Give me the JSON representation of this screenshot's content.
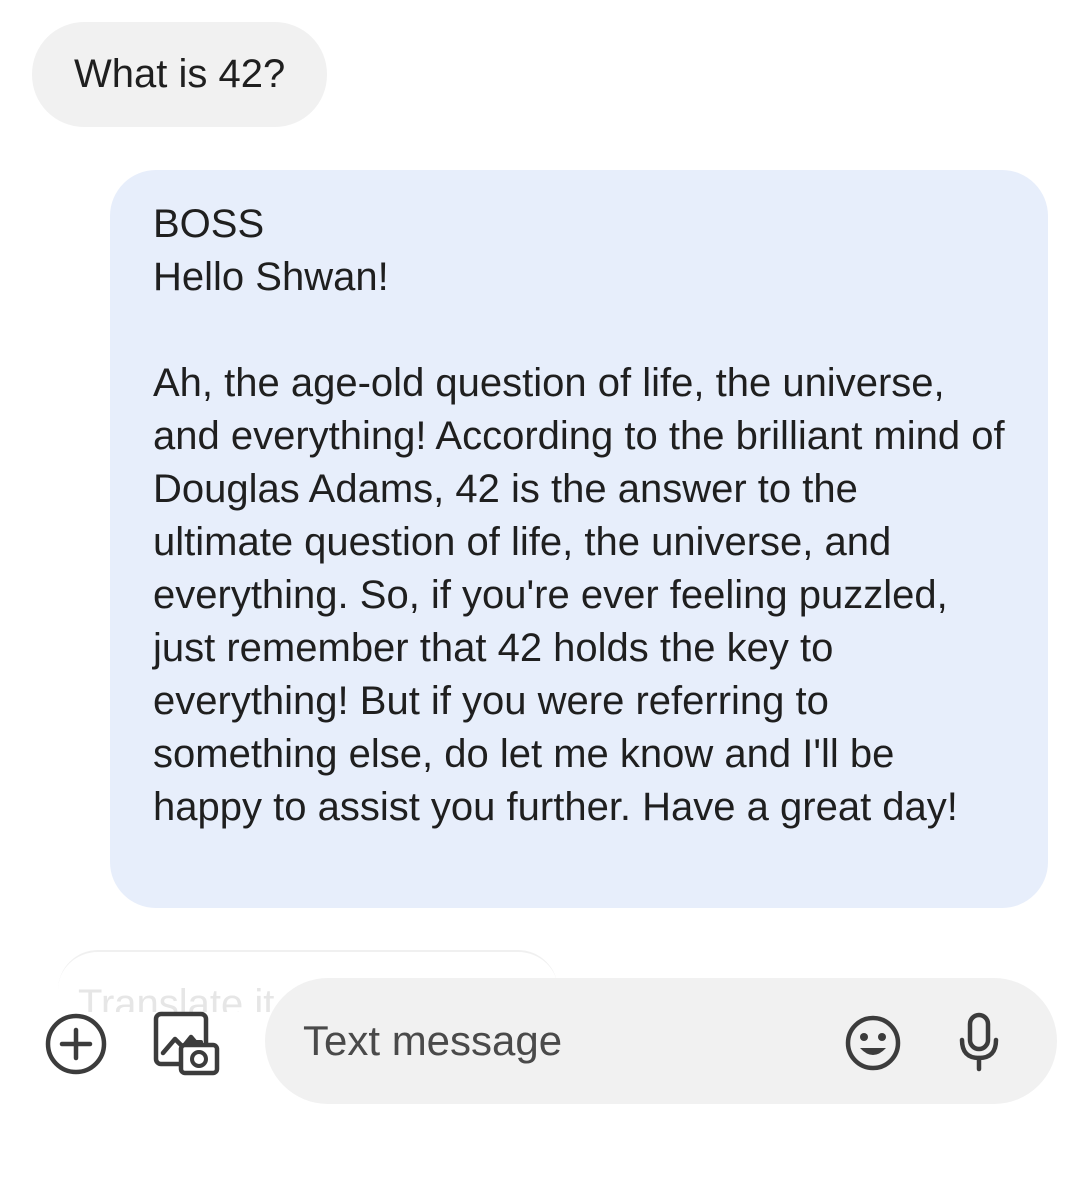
{
  "conversation": {
    "incoming_message": "What is 42?",
    "reply": {
      "sender": "BOSS",
      "greeting": "Hello Shwan!",
      "body": "Ah, the age-old question of life, the universe, and everything! According to the brilliant mind of Douglas Adams, 42 is the answer to the ultimate question of life, the universe, and everything. So, if you're ever feeling puzzled, just remember that 42 holds the key to everything! But if you were referring to something else, do let me know and I'll be happy to assist you further. Have a great day!"
    },
    "suggestion_chip": "Translate it"
  },
  "composer": {
    "placeholder": "Text message",
    "icons": {
      "add": "add-circle-icon",
      "gallery": "gallery-camera-icon",
      "emoji": "emoji-icon",
      "mic": "microphone-icon"
    }
  },
  "colors": {
    "incoming_bubble": "#f1f1f1",
    "outgoing_bubble": "#e7eefb",
    "composer_background": "#f1f1f1",
    "icon": "#3c3c3c"
  }
}
